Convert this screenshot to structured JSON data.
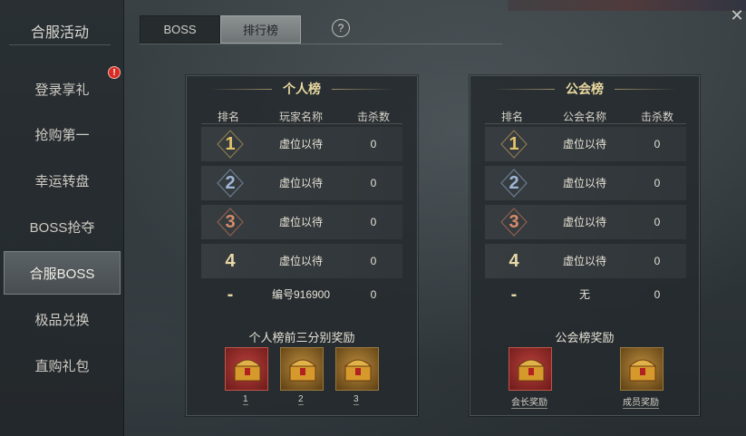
{
  "sidebar": {
    "title": "合服活动",
    "items": [
      {
        "label": "登录享礼",
        "badge": "!"
      },
      {
        "label": "抢购第一"
      },
      {
        "label": "幸运转盘"
      },
      {
        "label": "BOSS抢夺"
      },
      {
        "label": "合服BOSS",
        "active": true
      },
      {
        "label": "极品兑换"
      },
      {
        "label": "直购礼包"
      }
    ]
  },
  "tabs": {
    "boss": "BOSS",
    "ranking": "排行榜",
    "help": "?",
    "close": "✕"
  },
  "personal": {
    "title": "个人榜",
    "columns": [
      "排名",
      "玩家名称",
      "击杀数"
    ],
    "rows": [
      {
        "rank": "1",
        "name": "虚位以待",
        "kills": "0"
      },
      {
        "rank": "2",
        "name": "虚位以待",
        "kills": "0"
      },
      {
        "rank": "3",
        "name": "虚位以待",
        "kills": "0"
      },
      {
        "rank": "4",
        "name": "虚位以待",
        "kills": "0"
      },
      {
        "rank": "-",
        "name": "编号916900",
        "kills": "0"
      }
    ],
    "reward_title": "个人榜前三分别奖励",
    "rewards": [
      "1",
      "2",
      "3"
    ]
  },
  "guild": {
    "title": "公会榜",
    "columns": [
      "排名",
      "公会名称",
      "击杀数"
    ],
    "rows": [
      {
        "rank": "1",
        "name": "虚位以待",
        "kills": "0"
      },
      {
        "rank": "2",
        "name": "虚位以待",
        "kills": "0"
      },
      {
        "rank": "3",
        "name": "虚位以待",
        "kills": "0"
      },
      {
        "rank": "4",
        "name": "虚位以待",
        "kills": "0"
      },
      {
        "rank": "-",
        "name": "无",
        "kills": "0"
      }
    ],
    "reward_title": "公会榜奖励",
    "rewards": [
      "会长奖励",
      "成员奖励"
    ]
  },
  "colors": {
    "gold": "#e3c36a",
    "silver": "#9fb7d6",
    "bronze": "#d58b6a",
    "plain": "#e8d8a8"
  }
}
